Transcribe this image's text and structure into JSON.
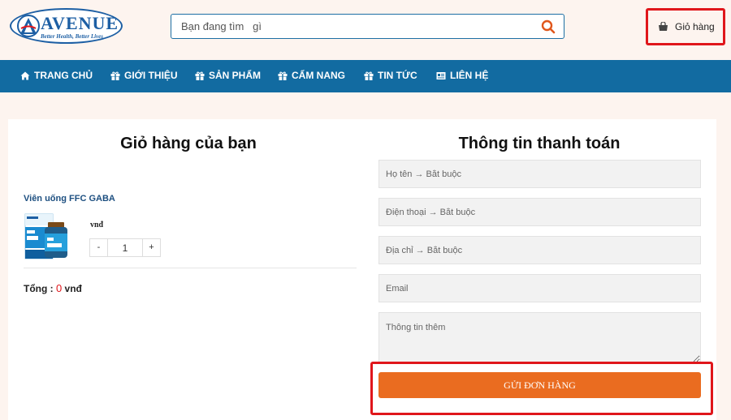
{
  "logo": {
    "name": "AVENUE",
    "tagline": "Better Health, Better Lives"
  },
  "search": {
    "placeholder": "Bạn đang tìm   gì",
    "icon": "search-icon"
  },
  "header": {
    "cart_label": "Giỏ hàng",
    "cart_icon": "shopping-bag-icon"
  },
  "nav": {
    "items": [
      {
        "label": "TRANG CHỦ",
        "icon": "home-icon"
      },
      {
        "label": "GIỚI THIỆU",
        "icon": "gift-icon"
      },
      {
        "label": "SẢN PHẨM",
        "icon": "gift-icon"
      },
      {
        "label": "CẨM NANG",
        "icon": "gift-icon"
      },
      {
        "label": "TIN TỨC",
        "icon": "gift-icon"
      },
      {
        "label": "LIÊN HỆ",
        "icon": "contact-card-icon"
      }
    ]
  },
  "cart": {
    "title": "Giỏ hàng của bạn",
    "product": {
      "name": "Viên uống FFC GABA",
      "price": "vnđ",
      "quantity": "1",
      "minus_label": "-",
      "plus_label": "+"
    },
    "total_label": "Tổng : ",
    "total_value": "0",
    "total_unit": " vnđ"
  },
  "checkout": {
    "title": "Thông tin thanh toán",
    "name_placeholder": "Họ tên → Bắt buộc",
    "phone_placeholder": "Điện thoại → Bắt buộc",
    "address_placeholder": "Địa chỉ → Bắt buộc",
    "email_placeholder": "Email",
    "notes_placeholder": "Thông tin thêm",
    "submit_label": "GỬI ĐƠN HÀNG"
  },
  "colors": {
    "nav_bg": "#126ba1",
    "brand_blue": "#1d5fa4",
    "submit_orange": "#ea6c20",
    "highlight_red": "#e0161b",
    "page_bg": "#fdf4ef"
  }
}
